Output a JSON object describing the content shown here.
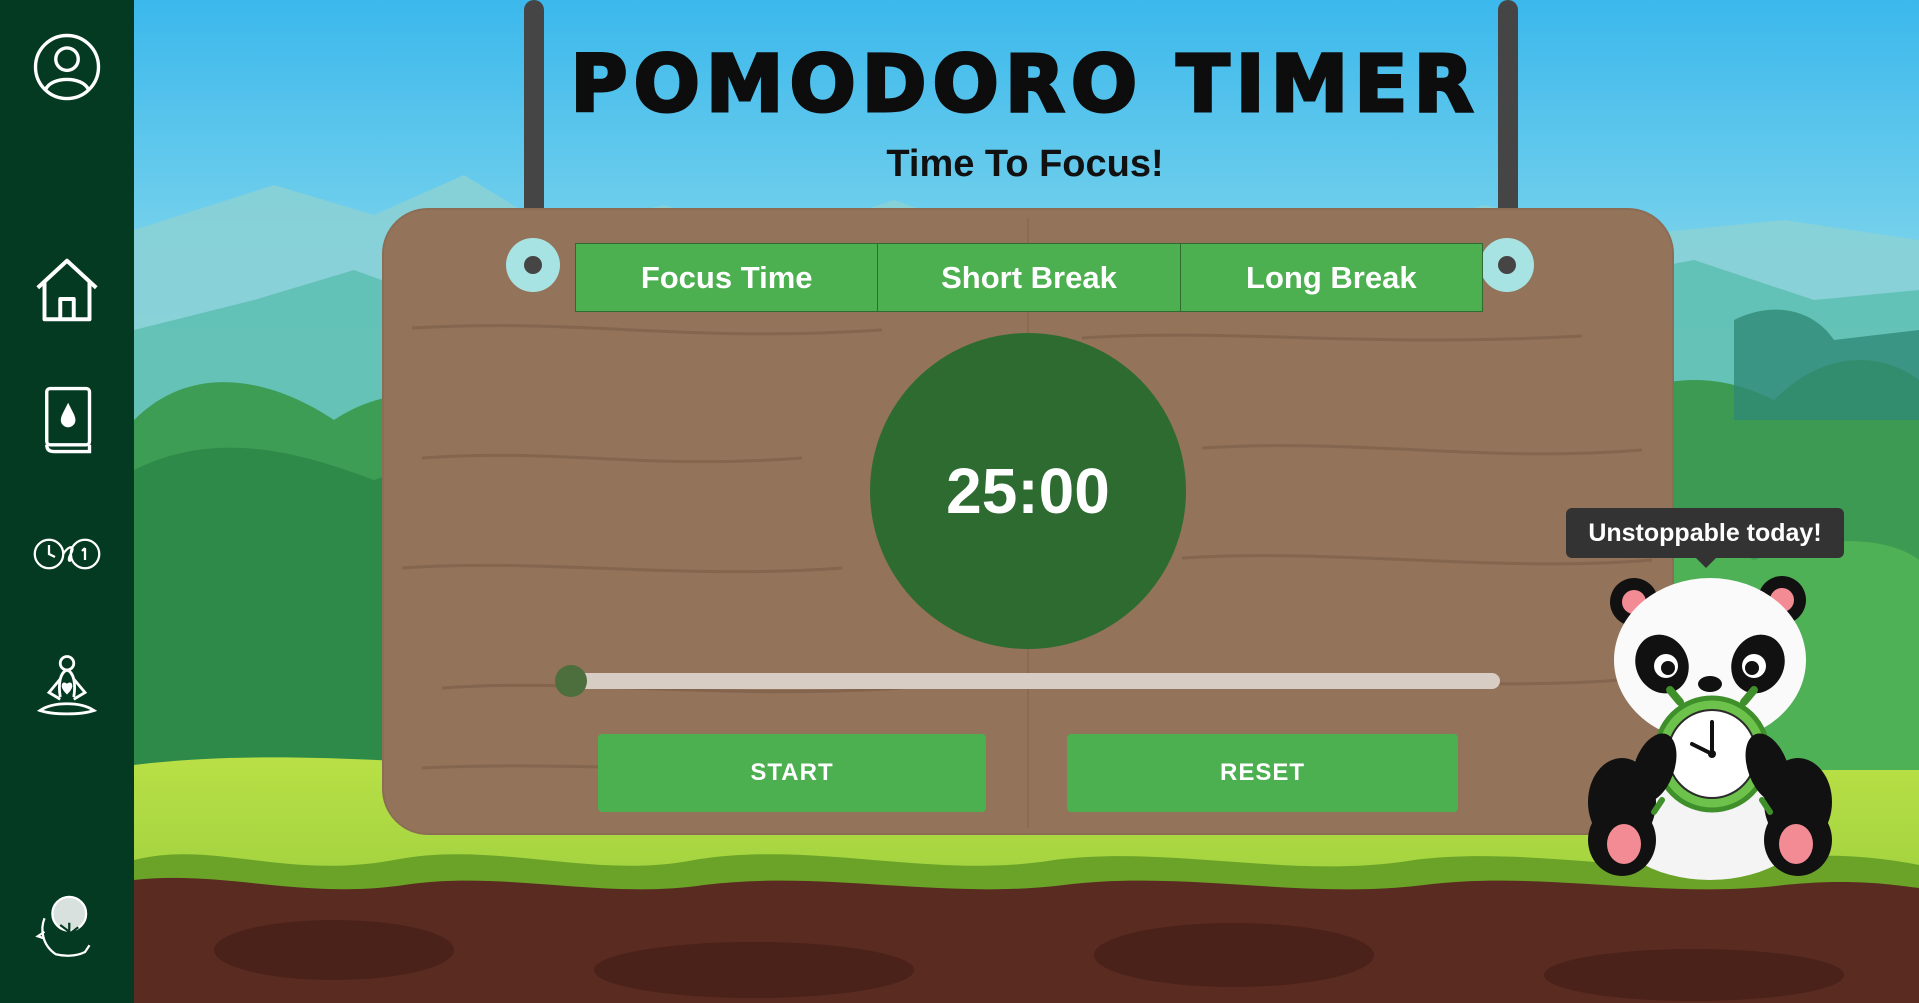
{
  "sidebar": {
    "items": [
      {
        "icon": "user-icon"
      },
      {
        "icon": "home-icon"
      },
      {
        "icon": "journal-book-icon"
      },
      {
        "icon": "infinity-clock-icon"
      },
      {
        "icon": "meditation-icon"
      },
      {
        "icon": "tree-head-logo-icon"
      }
    ]
  },
  "header": {
    "title": "POMODORO TIMER",
    "subtitle": "Time To Focus!"
  },
  "tabs": [
    {
      "label": "Focus Time"
    },
    {
      "label": "Short Break"
    },
    {
      "label": "Long Break"
    }
  ],
  "timer": {
    "display": "25:00",
    "progress": 0
  },
  "buttons": {
    "start": "START",
    "reset": "RESET"
  },
  "mascot": {
    "message": "Unstoppable today!"
  },
  "colors": {
    "sidebar": "#053a22",
    "accent_green": "#4caf50",
    "timer_circle": "#2e6b30",
    "board_wood": "#93735a",
    "sky": "#3bb8ec"
  }
}
